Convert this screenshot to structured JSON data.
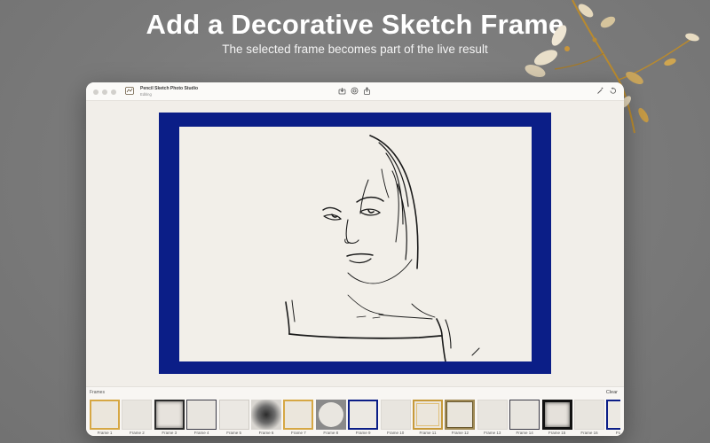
{
  "promo": {
    "headline": "Add a Decorative Sketch Frame",
    "subheadline": "The selected frame becomes part of the live result"
  },
  "window": {
    "app_title": "Pencil Sketch Photo Studio",
    "app_subtitle": "Editing",
    "toolbar_icons": [
      "import-icon",
      "filter-icon",
      "share-icon"
    ],
    "right_icons": [
      "magic-wand-icon",
      "reset-icon"
    ]
  },
  "canvas": {
    "frame_color": "#0b1e87",
    "paper_color": "#f2efe9"
  },
  "frames_panel": {
    "label": "Frames",
    "clear_label": "Clear",
    "items": [
      {
        "name": "Frame 1",
        "style": "gold-border"
      },
      {
        "name": "Frame 2",
        "style": "plain-light"
      },
      {
        "name": "Frame 3",
        "style": "dark-shadow"
      },
      {
        "name": "Frame 4",
        "style": "thin-dark"
      },
      {
        "name": "Frame 5",
        "style": "plain-thin"
      },
      {
        "name": "Frame 6",
        "style": "dark-vignette"
      },
      {
        "name": "Frame 7",
        "style": "gold-border"
      },
      {
        "name": "Frame 8",
        "style": "circle"
      },
      {
        "name": "Frame 9",
        "style": "navy-border"
      },
      {
        "name": "Frame 10",
        "style": "plain-light"
      },
      {
        "name": "Frame 11",
        "style": "gold-double"
      },
      {
        "name": "Frame 12",
        "style": "olive-border"
      },
      {
        "name": "Frame 13",
        "style": "plain-light"
      },
      {
        "name": "Frame 14",
        "style": "thin-dark"
      },
      {
        "name": "Frame 15",
        "style": "black-thick"
      },
      {
        "name": "Frame 16",
        "style": "plain-light"
      },
      {
        "name": "Frame",
        "style": "navy-border"
      }
    ]
  }
}
